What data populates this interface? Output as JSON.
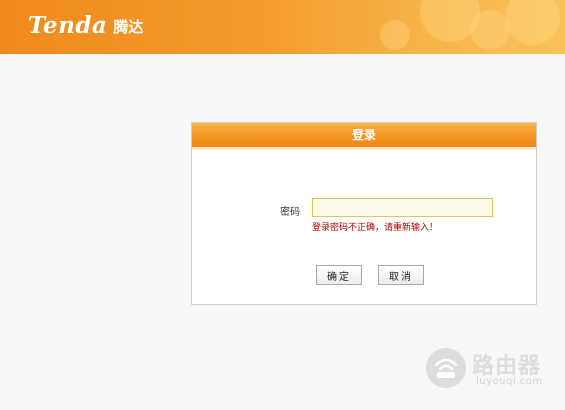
{
  "header": {
    "logo_en": "Tenda",
    "logo_cn": "腾达"
  },
  "login": {
    "title": "登录",
    "password_label": "密码",
    "password_value": "",
    "error": "登录密码不正确，请重新输入！",
    "ok_label": "确定",
    "cancel_label": "取消"
  },
  "watermark": {
    "text": "路由器",
    "sub": "luyouqi.com"
  },
  "colors": {
    "brand_orange": "#f39320",
    "error_red": "#b40000"
  }
}
